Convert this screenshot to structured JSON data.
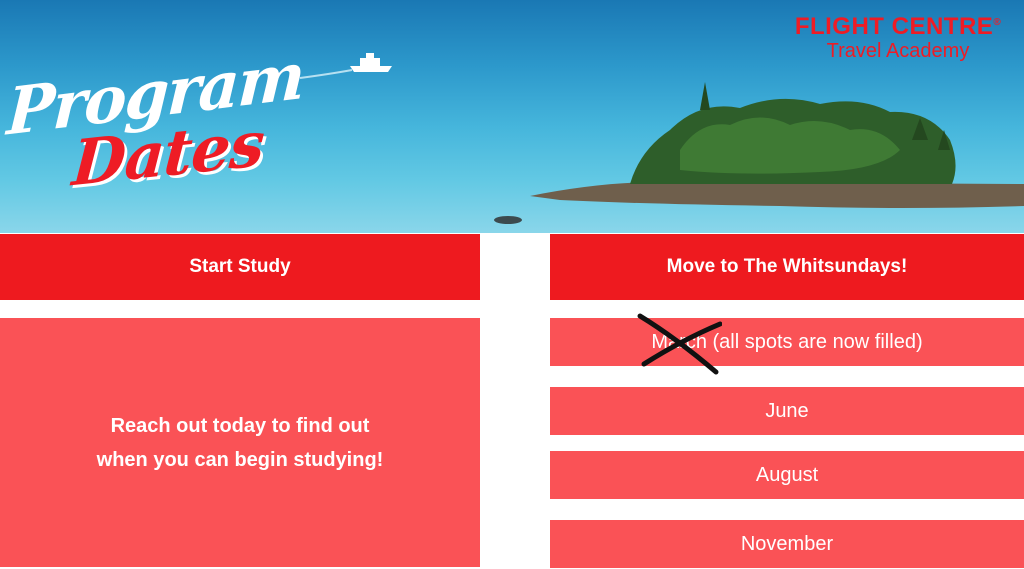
{
  "brand": {
    "name": "FLIGHT CENTRE",
    "suffix": "®",
    "subtitle": "Travel Academy"
  },
  "hero": {
    "title_line1": "Program",
    "title_line2": "Dates"
  },
  "left_column": {
    "header": "Start Study",
    "body": "Reach out today to find out when you can begin studying!"
  },
  "right_column": {
    "header": "Move to The Whitsundays!",
    "dates": [
      {
        "label": "March (all spots are now filled)",
        "crossed_out": true
      },
      {
        "label": "June",
        "crossed_out": false
      },
      {
        "label": "August",
        "crossed_out": false
      },
      {
        "label": "November",
        "crossed_out": false
      }
    ]
  },
  "colors": {
    "header_red": "#ee1a1f",
    "panel_red": "#fa5256",
    "brand_red": "#ee1c25",
    "sea_blue": "#2c98cb"
  },
  "icons": {
    "cross_mark": "x-mark-icon",
    "boat": "boat-image",
    "island": "island-image"
  }
}
